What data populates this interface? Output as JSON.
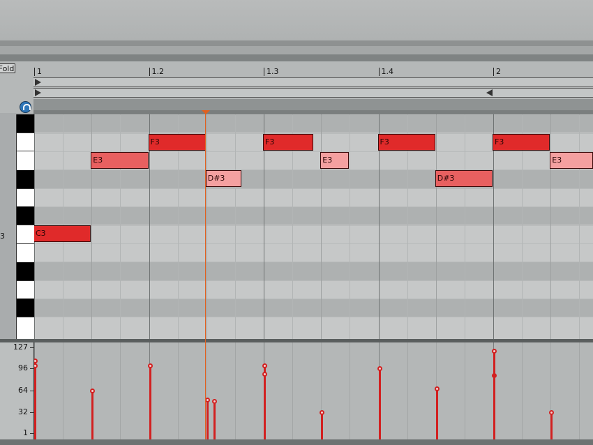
{
  "toolbar": {
    "fold_label": "Fold"
  },
  "ruler": {
    "labels": [
      "1",
      "1.2",
      "1.3",
      "1.4",
      "2"
    ]
  },
  "keyboard": {
    "octave_label": "3"
  },
  "notes": [
    {
      "pitch": "C3",
      "label": "C3",
      "start": 0.0,
      "length": 0.5,
      "velocity": 100,
      "color": "#e02a2a"
    },
    {
      "pitch": "E3",
      "label": "E3",
      "start": 0.5,
      "length": 0.5,
      "velocity": 64,
      "color": "#e86060"
    },
    {
      "pitch": "F3",
      "label": "F3",
      "start": 1.0,
      "length": 0.5,
      "velocity": 100,
      "color": "#e02a2a"
    },
    {
      "pitch": "D#3",
      "label": "D#3",
      "start": 1.5,
      "length": 0.3125,
      "velocity": 48,
      "color": "#f4a0a0"
    },
    {
      "pitch": "F3",
      "label": "F3",
      "start": 2.0,
      "length": 0.4375,
      "velocity": 100,
      "color": "#e02a2a"
    },
    {
      "pitch": "E3",
      "label": "E3",
      "start": 2.5,
      "length": 0.25,
      "velocity": 32,
      "color": "#f4a0a0"
    },
    {
      "pitch": "F3",
      "label": "F3",
      "start": 3.0,
      "length": 0.5,
      "velocity": 96,
      "color": "#e02a2a"
    },
    {
      "pitch": "D#3",
      "label": "D#3",
      "start": 3.5,
      "length": 0.5,
      "velocity": 64,
      "color": "#e86060"
    },
    {
      "pitch": "F3",
      "label": "F3",
      "start": 4.0,
      "length": 0.5,
      "velocity": 120,
      "color": "#e02a2a"
    },
    {
      "pitch": "E3",
      "label": "E3",
      "start": 4.5,
      "length": 0.375,
      "velocity": 32,
      "color": "#f4a0a0"
    }
  ],
  "velocity_lane": {
    "labels": [
      "127",
      "96",
      "64",
      "32",
      "1"
    ],
    "values": [
      127,
      1
    ],
    "events": [
      {
        "beat": 0.0,
        "velocity": 108,
        "filled": false
      },
      {
        "beat": 0.0,
        "velocity": 100,
        "filled": false
      },
      {
        "beat": 0.5,
        "velocity": 64,
        "filled": false
      },
      {
        "beat": 1.0,
        "velocity": 100,
        "filled": false
      },
      {
        "beat": 1.5,
        "velocity": 50,
        "filled": false
      },
      {
        "beat": 1.5625,
        "velocity": 48,
        "filled": false
      },
      {
        "beat": 2.0,
        "velocity": 100,
        "filled": false
      },
      {
        "beat": 2.0,
        "velocity": 88,
        "filled": false
      },
      {
        "beat": 2.5,
        "velocity": 32,
        "filled": false
      },
      {
        "beat": 3.0,
        "velocity": 96,
        "filled": false
      },
      {
        "beat": 3.5,
        "velocity": 67,
        "filled": false
      },
      {
        "beat": 4.0,
        "velocity": 122,
        "filled": false
      },
      {
        "beat": 4.0,
        "velocity": 86,
        "filled": true
      },
      {
        "beat": 4.5,
        "velocity": 32,
        "filled": false
      }
    ]
  },
  "playhead": {
    "beat": 1.5
  }
}
